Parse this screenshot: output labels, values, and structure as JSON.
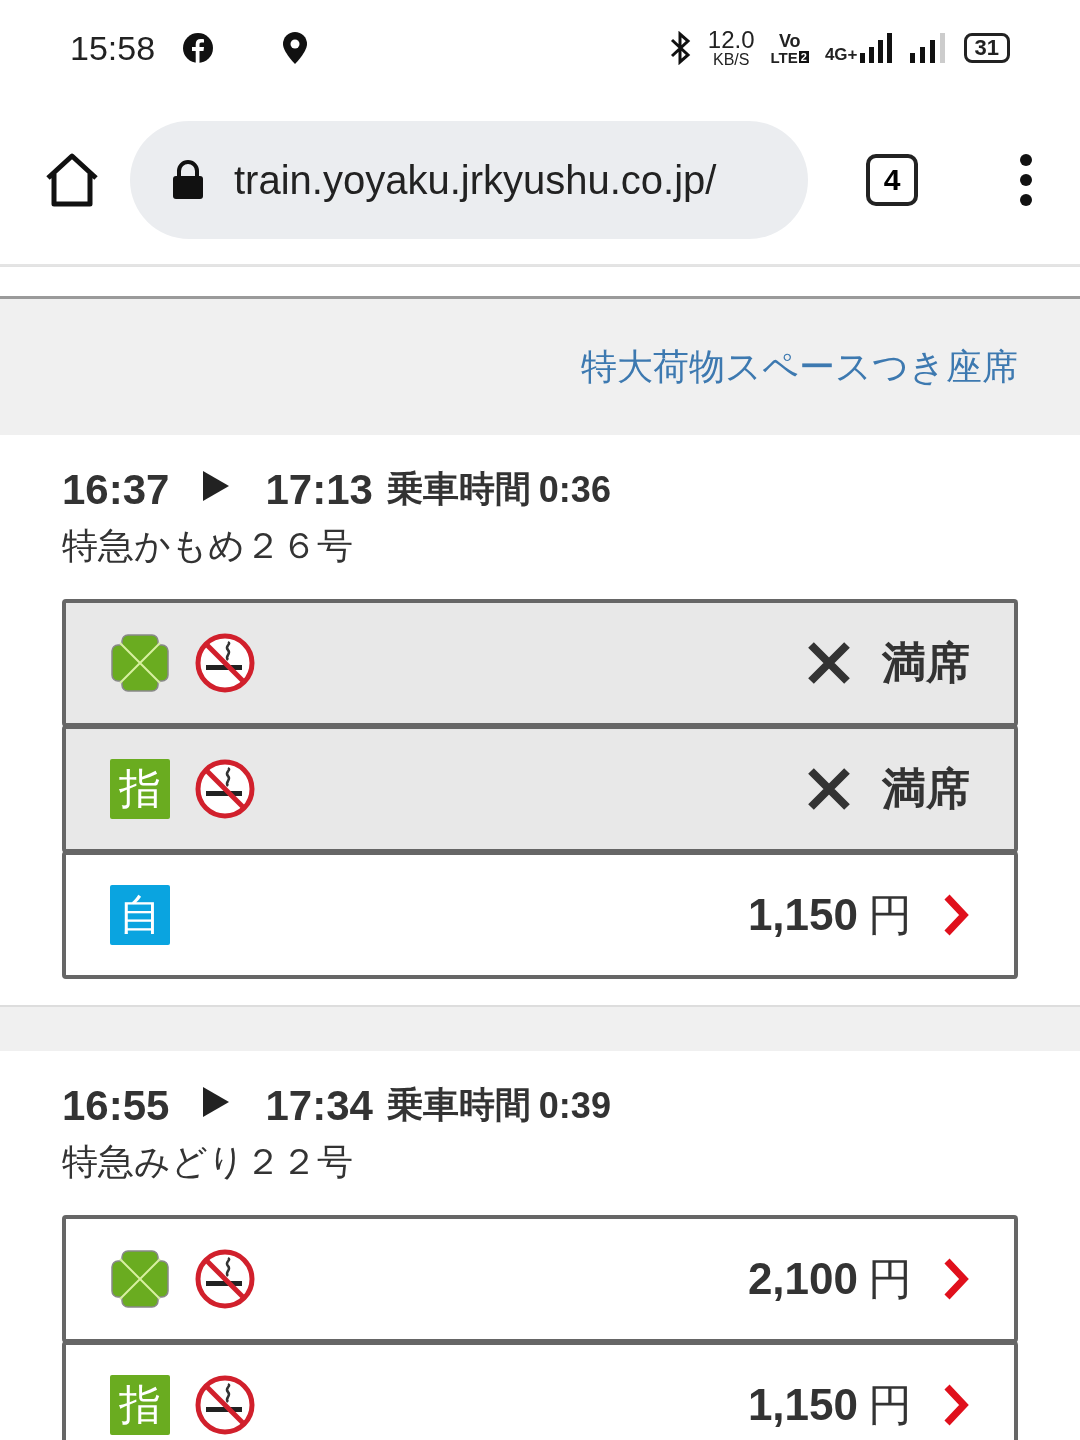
{
  "status_bar": {
    "time": "15:58",
    "speed": "12.0",
    "speed_unit": "KB/S",
    "volte": "Vo",
    "volte_sub": "LTE",
    "sim": "2",
    "network": "4G+",
    "battery": "31"
  },
  "browser": {
    "url": "train.yoyaku.jrkyushu.co.jp/",
    "tab_count": "4"
  },
  "filter_link": "特大荷物スペースつき座席",
  "trains": [
    {
      "depart": "16:37",
      "arrive": "17:13",
      "duration_label": "乗車時間",
      "duration": "0:36",
      "name": "特急かもめ２６号",
      "seats": [
        {
          "kind": "green",
          "no_smoking": true,
          "full": true,
          "status": "満席"
        },
        {
          "kind": "reserved",
          "badge": "指",
          "no_smoking": true,
          "full": true,
          "status": "満席"
        },
        {
          "kind": "unreserved",
          "badge": "自",
          "no_smoking": false,
          "full": false,
          "price": "1,150",
          "currency": "円"
        }
      ]
    },
    {
      "depart": "16:55",
      "arrive": "17:34",
      "duration_label": "乗車時間",
      "duration": "0:39",
      "name": "特急みどり２２号",
      "seats": [
        {
          "kind": "green",
          "no_smoking": true,
          "full": false,
          "price": "2,100",
          "currency": "円"
        },
        {
          "kind": "reserved",
          "badge": "指",
          "no_smoking": true,
          "full": false,
          "price": "1,150",
          "currency": "円"
        }
      ]
    }
  ]
}
